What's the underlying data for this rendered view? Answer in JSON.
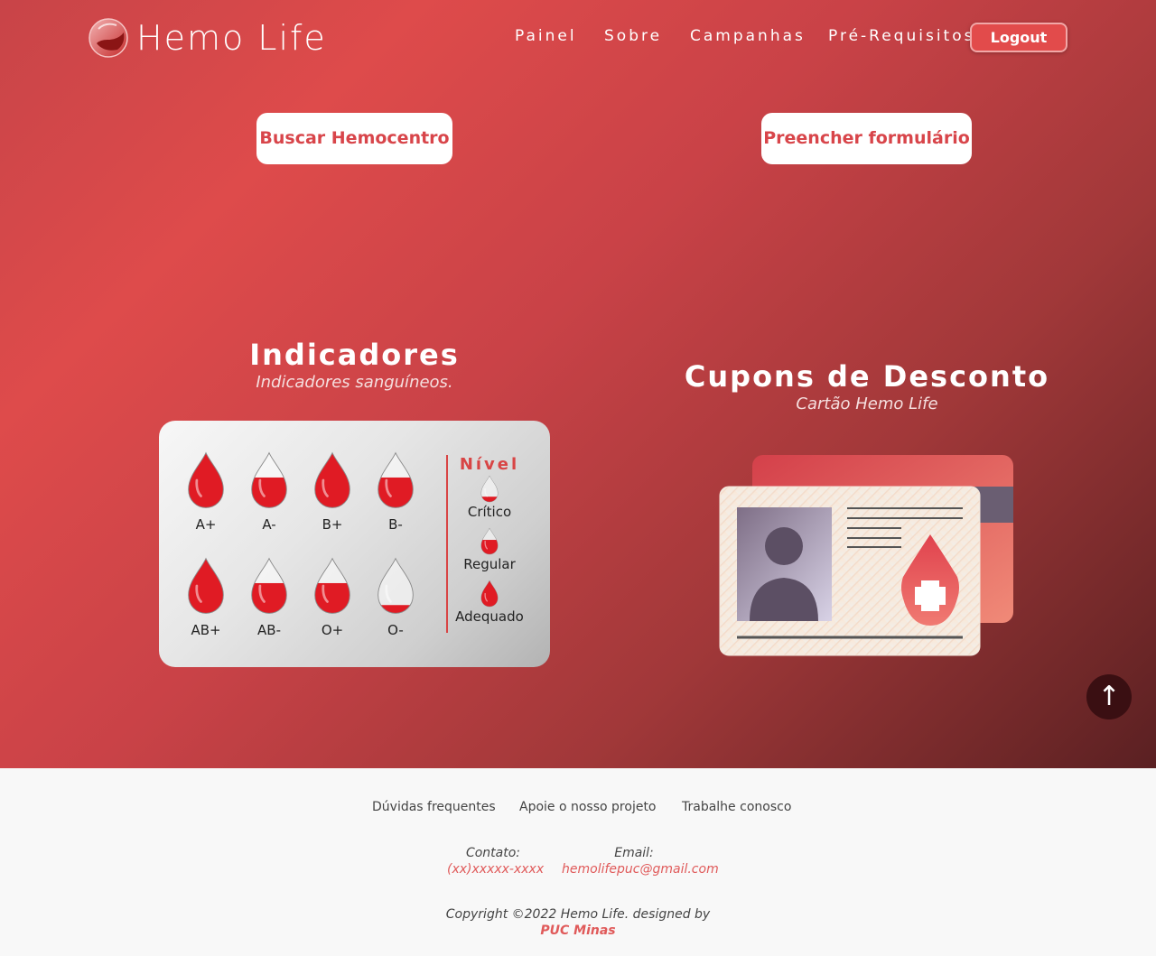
{
  "header": {
    "logo_text": "Hemo Life",
    "nav": [
      "Painel",
      "Sobre",
      "Campanhas",
      "Pré-Requisitos"
    ],
    "logout_label": "Logout"
  },
  "actions": {
    "search_label": "Buscar Hemocentro",
    "form_label": "Preencher formulário"
  },
  "indicators": {
    "title": "Indicadores",
    "subtitle": "Indicadores sanguíneos.",
    "types": [
      {
        "label": "A+",
        "fill": 1.0
      },
      {
        "label": "A-",
        "fill": 0.55
      },
      {
        "label": "B+",
        "fill": 1.0
      },
      {
        "label": "B-",
        "fill": 0.55
      },
      {
        "label": "AB+",
        "fill": 1.0
      },
      {
        "label": "AB-",
        "fill": 0.55
      },
      {
        "label": "O+",
        "fill": 0.55
      },
      {
        "label": "O-",
        "fill": 0.15
      }
    ],
    "legend_title": "Nível",
    "legend": [
      {
        "label": "Crítico",
        "fill": 0.2
      },
      {
        "label": "Regular",
        "fill": 0.55
      },
      {
        "label": "Adequado",
        "fill": 1.0
      }
    ]
  },
  "coupons": {
    "title": "Cupons de Desconto",
    "subtitle": "Cartão Hemo Life"
  },
  "scroll_top_icon": "arrow-up-icon",
  "footer": {
    "links": [
      "Dúvidas frequentes",
      "Apoie o nosso projeto",
      "Trabalhe conosco"
    ],
    "contact_label": "Contato:",
    "contact_value": "(xx)xxxxx-xxxx",
    "email_label": "Email:",
    "email_value": "hemolifepuc@gmail.com",
    "copyright": "Copyright ©2022 Hemo Life. designed by",
    "brand": "PUC Minas"
  },
  "colors": {
    "accent": "#d84545",
    "drop_red": "#e01b24",
    "footer_bg": "#f8f8f8"
  }
}
